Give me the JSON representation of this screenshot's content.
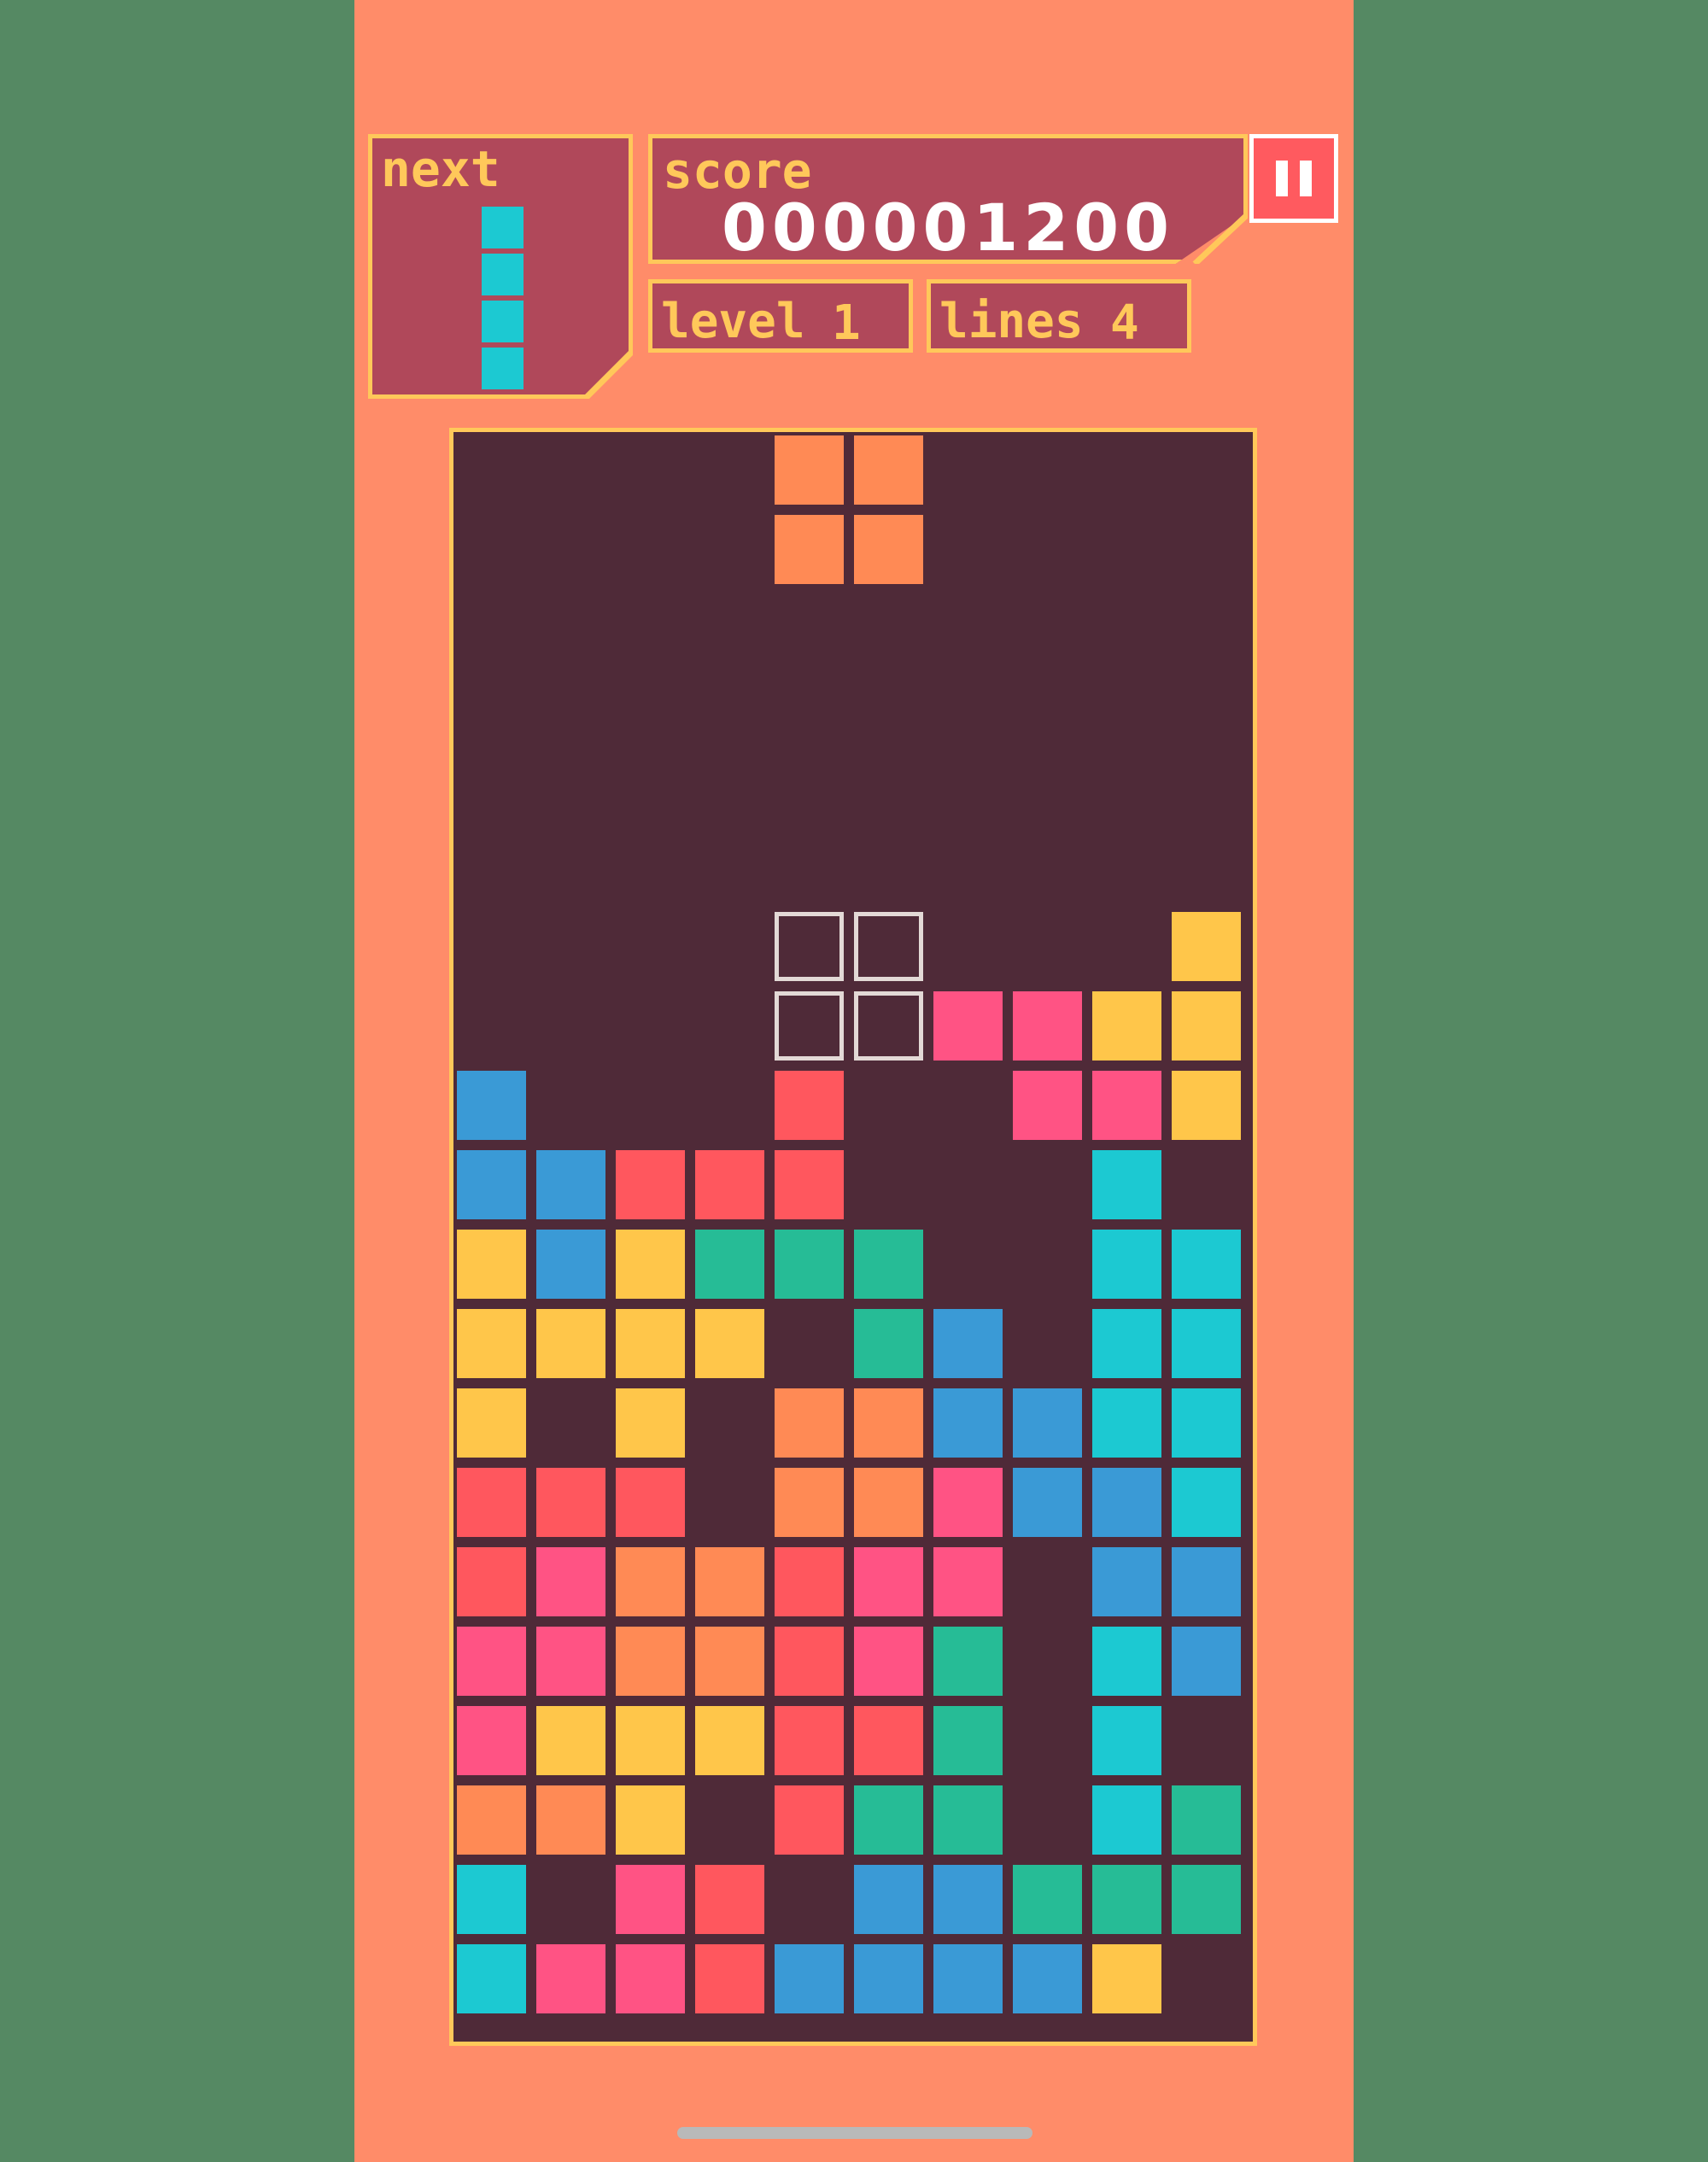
{
  "hud": {
    "next_label": "next",
    "score_label": "score",
    "score_value": "000001200",
    "level_label": "level",
    "level_value": "1",
    "lines_label": "lines",
    "lines_value": "4"
  },
  "colors": {
    "background": "#558963",
    "frame": "#ff8c69",
    "panel": "#b0485a",
    "border": "#ffc85a",
    "board": "#4f2a38",
    "pause": "#ff5a5f",
    "O": "#ff8a55",
    "Y": "#ffc64a",
    "B": "#3a9ad6",
    "R": "#ff575e",
    "G": "#26bc96",
    "C": "#1cc9d2",
    "P": "#ff5384"
  },
  "next_piece": {
    "type": "I",
    "color": "#1cc9d2"
  },
  "active_piece": {
    "type": "O",
    "color": "#ff8a55",
    "cells": [
      [
        0,
        4
      ],
      [
        0,
        5
      ],
      [
        1,
        4
      ],
      [
        1,
        5
      ]
    ]
  },
  "ghost_piece": {
    "cells": [
      [
        6,
        4
      ],
      [
        6,
        5
      ],
      [
        7,
        4
      ],
      [
        7,
        5
      ]
    ]
  },
  "board": {
    "cols": 10,
    "rows": 20,
    "grid": [
      "..........",
      "..........",
      "..........",
      "..........",
      "..........",
      "..........",
      ".........Y",
      "......PPYY",
      "B...R..PPY",
      "BBRRR...C.",
      "YBYGGG..CC",
      "YYYY.GB.CC",
      "Y.Y.OOBBCC",
      "RRR.OOPBBC",
      "RPOORPP.BB",
      "PPOORPG.CB",
      "PYYYRRG.C.",
      "OOY.RGG.CG",
      "C.PR.BBGGG",
      "CPPRBBBBY."
    ]
  }
}
